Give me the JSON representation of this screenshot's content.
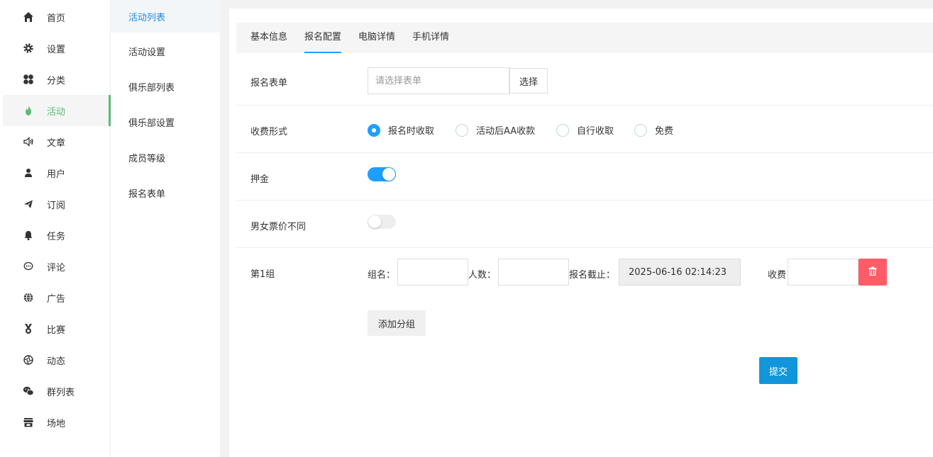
{
  "sidebar": {
    "items": [
      {
        "label": "首页",
        "icon": "home-icon"
      },
      {
        "label": "设置",
        "icon": "gear-icon"
      },
      {
        "label": "分类",
        "icon": "category-icon"
      },
      {
        "label": "活动",
        "icon": "flame-icon",
        "active": true
      },
      {
        "label": "文章",
        "icon": "speaker-icon"
      },
      {
        "label": "用户",
        "icon": "user-icon"
      },
      {
        "label": "订阅",
        "icon": "send-icon"
      },
      {
        "label": "任务",
        "icon": "bell-icon"
      },
      {
        "label": "评论",
        "icon": "comment-icon"
      },
      {
        "label": "广告",
        "icon": "globe-icon"
      },
      {
        "label": "比赛",
        "icon": "medal-icon"
      },
      {
        "label": "动态",
        "icon": "aperture-icon"
      },
      {
        "label": "群列表",
        "icon": "wechat-icon"
      },
      {
        "label": "场地",
        "icon": "store-icon"
      }
    ],
    "accent_color": "#5fb878"
  },
  "submenu": {
    "items": [
      {
        "label": "活动列表",
        "active": true
      },
      {
        "label": "活动设置"
      },
      {
        "label": "俱乐部列表"
      },
      {
        "label": "俱乐部设置"
      },
      {
        "label": "成员等级"
      },
      {
        "label": "报名表单"
      }
    ]
  },
  "tabs": [
    {
      "label": "基本信息"
    },
    {
      "label": "报名配置",
      "active": true
    },
    {
      "label": "电脑详情"
    },
    {
      "label": "手机详情"
    }
  ],
  "form": {
    "signup_form": {
      "label": "报名表单",
      "placeholder": "请选择表单",
      "value": "",
      "select_button": "选择"
    },
    "fee_type": {
      "label": "收费形式",
      "options": [
        "报名时收取",
        "活动后AA收款",
        "自行收取",
        "免费"
      ],
      "selected_index": 0
    },
    "deposit": {
      "label": "押金",
      "enabled": true
    },
    "gender_price": {
      "label": "男女票价不同",
      "enabled": false
    },
    "group": {
      "label": "第1组",
      "name_label": "组名：",
      "name_value": "",
      "count_label": "人数：",
      "count_value": "",
      "deadline_label": "报名截止：",
      "deadline_value": "2025-06-16 02:14:23",
      "fee_label": "收费",
      "fee_value": ""
    },
    "add_group_button": "添加分组",
    "submit_button": "提交"
  },
  "colors": {
    "primary": "#1e9fff",
    "submit": "#1296db",
    "danger": "#ff5c67"
  }
}
